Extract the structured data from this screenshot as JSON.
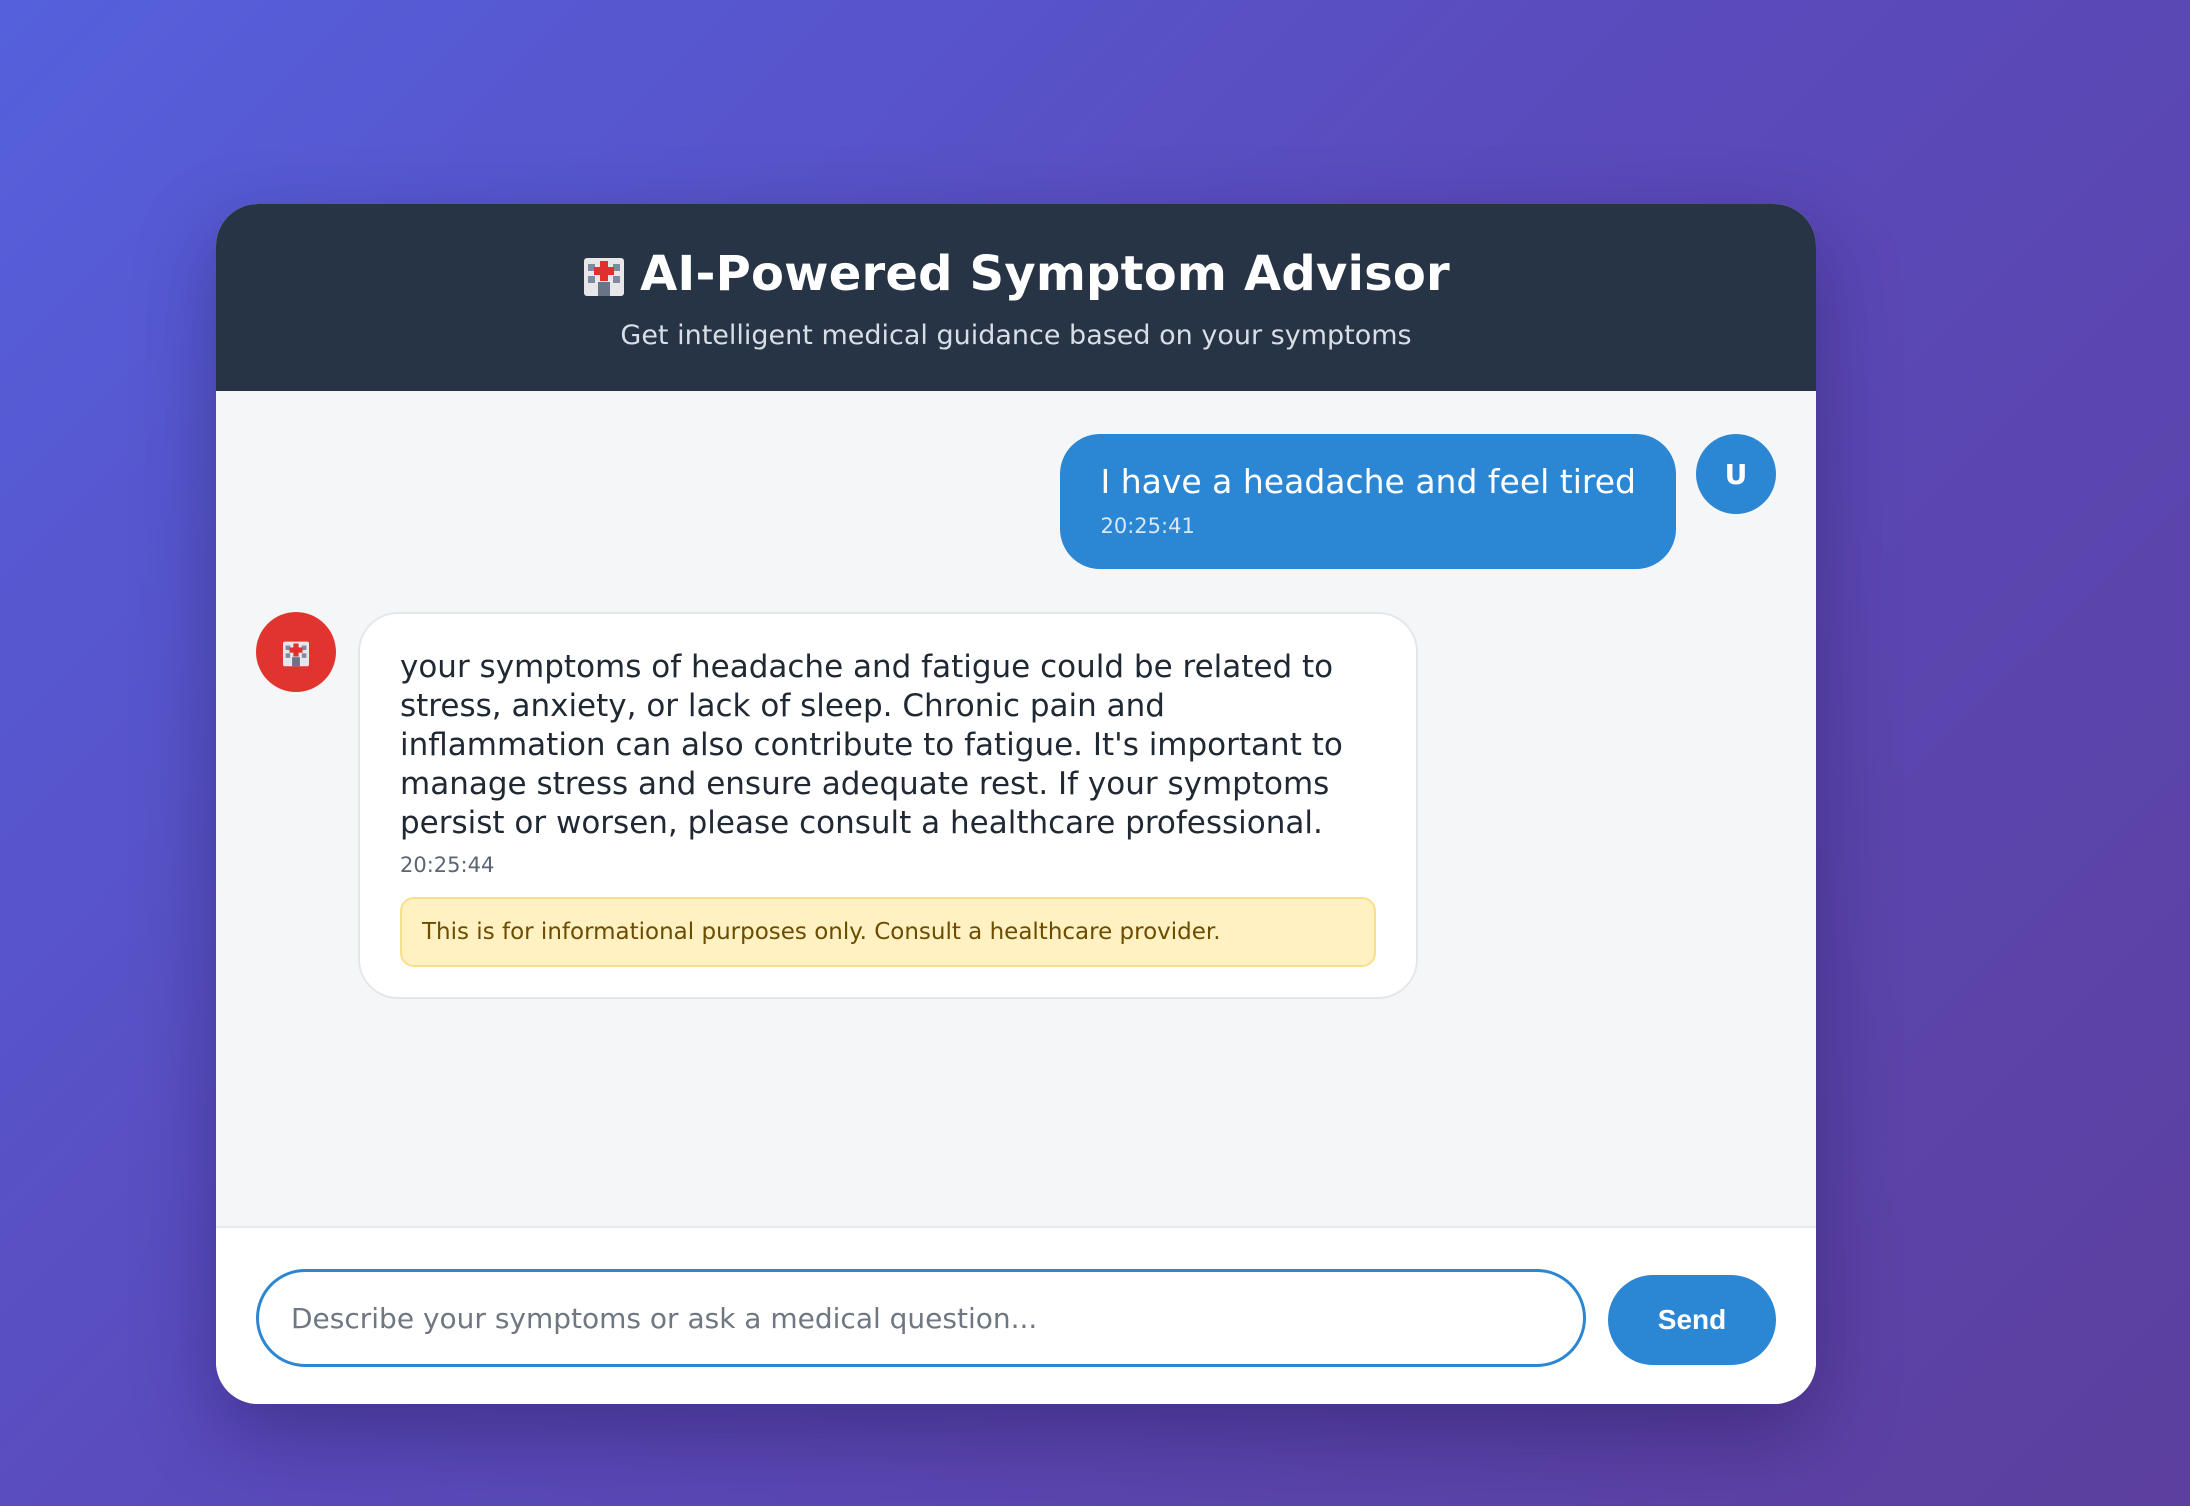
{
  "header": {
    "title": "AI-Powered Symptom Advisor",
    "subtitle": "Get intelligent medical guidance based on your symptoms",
    "icon": "hospital-icon"
  },
  "messages": [
    {
      "sender": "user",
      "avatar_label": "U",
      "text": "I have a headache and feel tired",
      "time": "20:25:41"
    },
    {
      "sender": "bot",
      "avatar_icon": "hospital-icon",
      "text": "your symptoms of headache and fatigue could be related to stress, anxiety, or lack of sleep. Chronic pain and inflammation can also contribute to fatigue. It's important to manage stress and ensure adequate rest. If your symptoms persist or worsen, please consult a healthcare professional.",
      "time": "20:25:44",
      "disclaimer": "This is for informational purposes only. Consult a healthcare provider."
    }
  ],
  "composer": {
    "placeholder": "Describe your symptoms or ask a medical question...",
    "value": "",
    "send_label": "Send"
  },
  "colors": {
    "header_bg": "#263446",
    "accent": "#2b86d4",
    "bot_avatar": "#e1342f",
    "disclaimer_bg": "#fff1c2"
  }
}
